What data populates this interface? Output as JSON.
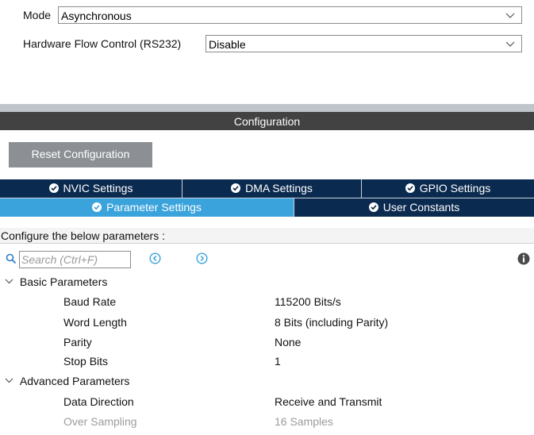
{
  "mode": {
    "label": "Mode",
    "value": "Asynchronous"
  },
  "flow_control": {
    "label": "Hardware Flow Control (RS232)",
    "value": "Disable"
  },
  "config_header": "Configuration",
  "reset_button": "Reset Configuration",
  "tabs": [
    {
      "label": "NVIC Settings",
      "active": false
    },
    {
      "label": "DMA Settings",
      "active": false
    },
    {
      "label": "GPIO Settings",
      "active": false
    },
    {
      "label": "Parameter Settings",
      "active": true
    },
    {
      "label": "User Constants",
      "active": false
    }
  ],
  "hint": "Configure the below parameters :",
  "search": {
    "placeholder": "Search (Ctrl+F)"
  },
  "groups": [
    {
      "name": "Basic Parameters",
      "params": [
        {
          "name": "Baud Rate",
          "value": "115200 Bits/s",
          "enabled": true
        },
        {
          "name": "Word Length",
          "value": "8 Bits (including Parity)",
          "enabled": true
        },
        {
          "name": "Parity",
          "value": "None",
          "enabled": true
        },
        {
          "name": "Stop Bits",
          "value": "1",
          "enabled": true
        }
      ]
    },
    {
      "name": "Advanced Parameters",
      "params": [
        {
          "name": "Data Direction",
          "value": "Receive and Transmit",
          "enabled": true
        },
        {
          "name": "Over Sampling",
          "value": "16 Samples",
          "enabled": false
        }
      ]
    }
  ],
  "colors": {
    "tab_dark": "#0a2a4f",
    "tab_active": "#3aa3dc",
    "config_bar": "#424242",
    "reset_button": "#8c9094",
    "nav_icon": "#3aa3dc"
  },
  "icons": [
    "chevron-down-icon",
    "check-circle-icon",
    "search-icon",
    "collapse-all-icon",
    "expand-all-icon",
    "info-icon"
  ]
}
